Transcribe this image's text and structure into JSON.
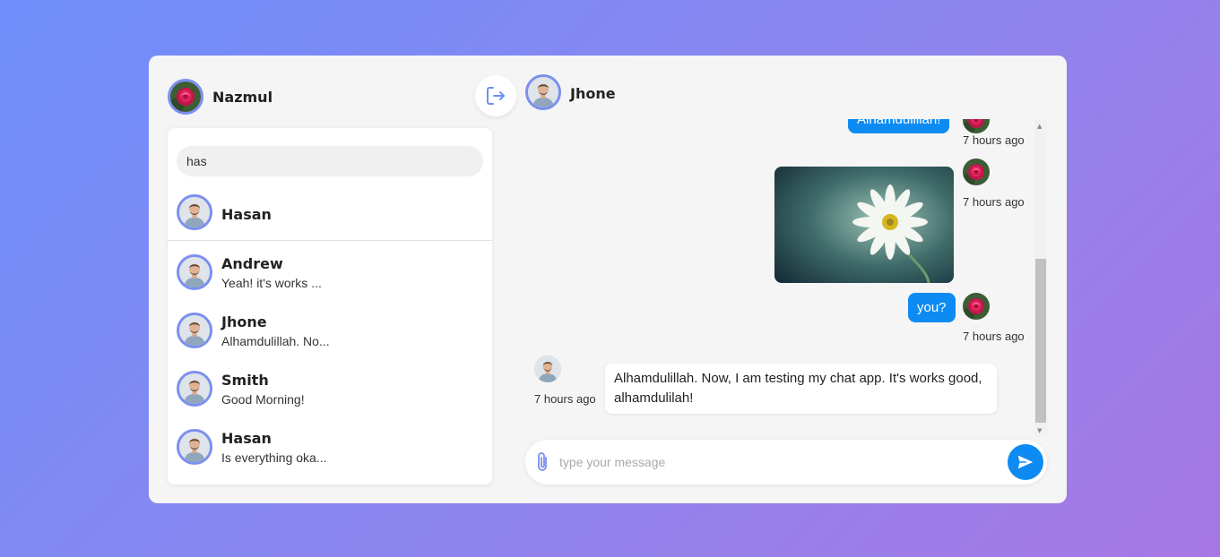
{
  "me": {
    "name": "Nazmul",
    "avatar_icon": "rose-avatar"
  },
  "header": {
    "logout_icon": "logout-icon"
  },
  "search": {
    "value": "has",
    "placeholder": ""
  },
  "search_results": [
    {
      "name": "Hasan"
    }
  ],
  "contacts": [
    {
      "name": "Andrew",
      "last_message": "Yeah! it's works ..."
    },
    {
      "name": "Jhone",
      "last_message": "Alhamdulillah. No..."
    },
    {
      "name": "Smith",
      "last_message": "Good Morning!"
    },
    {
      "name": "Hasan",
      "last_message": "Is everything oka..."
    }
  ],
  "chat": {
    "partner_name": "Jhone",
    "messages": [
      {
        "direction": "outgoing",
        "type": "text",
        "text": "Alhamdulillah!",
        "time": "7 hours ago"
      },
      {
        "direction": "outgoing",
        "type": "image",
        "image_icon": "daisy-flower-image",
        "time": "7 hours ago"
      },
      {
        "direction": "outgoing",
        "type": "text",
        "text": "you?",
        "time": "7 hours ago"
      },
      {
        "direction": "incoming",
        "type": "text",
        "text": "Alhamdulillah. Now, I am testing my chat app. It's works good, alhamdulilah!",
        "time": "7 hours ago"
      }
    ]
  },
  "composer": {
    "placeholder": "type your message",
    "value": "",
    "attach_icon": "paperclip-icon",
    "send_icon": "send-icon"
  },
  "colors": {
    "accent": "#0d8bf2",
    "avatar_ring": "#7b8ff0",
    "panel_bg": "#f5f5f5"
  }
}
